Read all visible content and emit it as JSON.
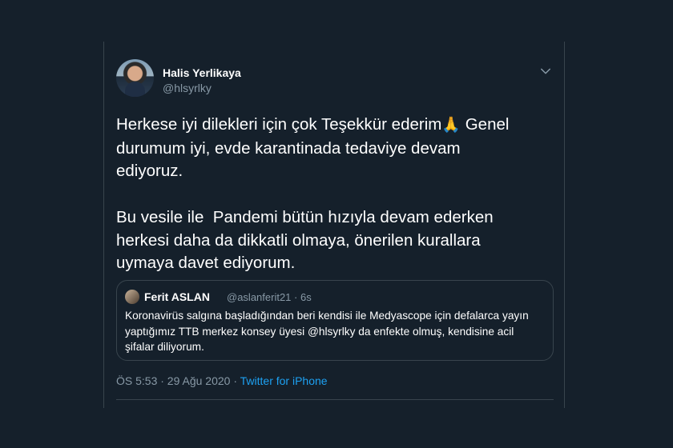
{
  "tweet": {
    "author": {
      "name": "Halis Yerlikaya",
      "handle": "@hlsyrlky"
    },
    "paragraphs": [
      {
        "line1_before_emoji": "Herkese iyi dilekleri için çok Teşekkür ederim",
        "emoji": "🙏",
        "rest": " Genel\ndurumum iyi, evde karantinada tedaviye devam\nediyoruz."
      },
      {
        "text": "Bu vesile ile  Pandemi bütün hızıyla devam ederken\nherkesi daha da dikkatli olmaya, önerilen kurallara\nuymaya davet ediyorum."
      }
    ],
    "quoted": {
      "name": "Ferit ASLAN",
      "handle": "@aslanferit21",
      "separator": " · ",
      "time": "6s",
      "text_lines": [
        "Koronavirüs salgına başladığından beri kendisi ile Medyascope için defalarca yayın",
        "yaptığımız TTB merkez konsey üyesi @hlsyrlky da enfekte olmuş, kendisine acil",
        "şifalar diliyorum."
      ]
    },
    "timestamp": "ÖS 5:53 · 29 Ağu 2020 · ",
    "source": "Twitter for iPhone",
    "icons": {
      "menu": "chevron-down-icon",
      "avatar": "profile-photo",
      "quoted_avatar": "profile-photo"
    },
    "colors": {
      "background": "#15202b",
      "border": "#38444d",
      "secondary_text": "#8899a6",
      "link": "#1da1f2"
    }
  }
}
